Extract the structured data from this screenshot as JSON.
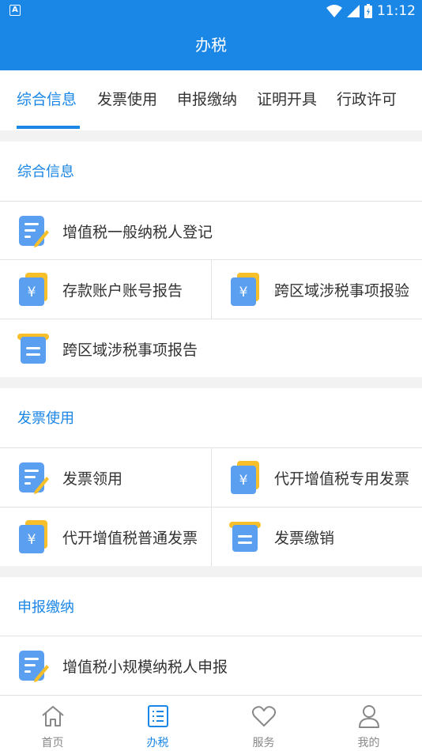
{
  "status_bar": {
    "time": "11:12",
    "app_indicator": "A"
  },
  "header": {
    "title": "办税"
  },
  "tabs": [
    {
      "label": "综合信息",
      "active": true
    },
    {
      "label": "发票使用"
    },
    {
      "label": "申报缴纳"
    },
    {
      "label": "证明开具"
    },
    {
      "label": "行政许可"
    }
  ],
  "sections": [
    {
      "title": "综合信息",
      "items": [
        {
          "label": "增值税一般纳税人登记",
          "icon": "form-edit-icon"
        },
        {
          "label": "存款账户账号报告",
          "icon": "yuan-doc-icon"
        },
        {
          "label": "跨区域涉税事项报验",
          "icon": "yuan-doc-icon"
        },
        {
          "label": "跨区域涉税事项报告",
          "icon": "list-doc-icon"
        }
      ]
    },
    {
      "title": "发票使用",
      "items": [
        {
          "label": "发票领用",
          "icon": "form-edit-icon"
        },
        {
          "label": "代开增值税专用发票",
          "icon": "yuan-doc-icon"
        },
        {
          "label": "代开增值税普通发票",
          "icon": "yuan-doc-icon"
        },
        {
          "label": "发票缴销",
          "icon": "list-doc-icon"
        }
      ]
    },
    {
      "title": "申报缴纳",
      "items": [
        {
          "label": "增值税小规模纳税人申报",
          "icon": "form-edit-icon"
        }
      ]
    }
  ],
  "bottom_nav": [
    {
      "label": "首页",
      "icon": "home-icon"
    },
    {
      "label": "办税",
      "icon": "list-icon",
      "active": true
    },
    {
      "label": "服务",
      "icon": "heart-icon"
    },
    {
      "label": "我的",
      "icon": "user-icon"
    }
  ],
  "colors": {
    "primary": "#1a86e6",
    "icon_blue": "#5b9ff0",
    "icon_yellow": "#f7c02b"
  }
}
